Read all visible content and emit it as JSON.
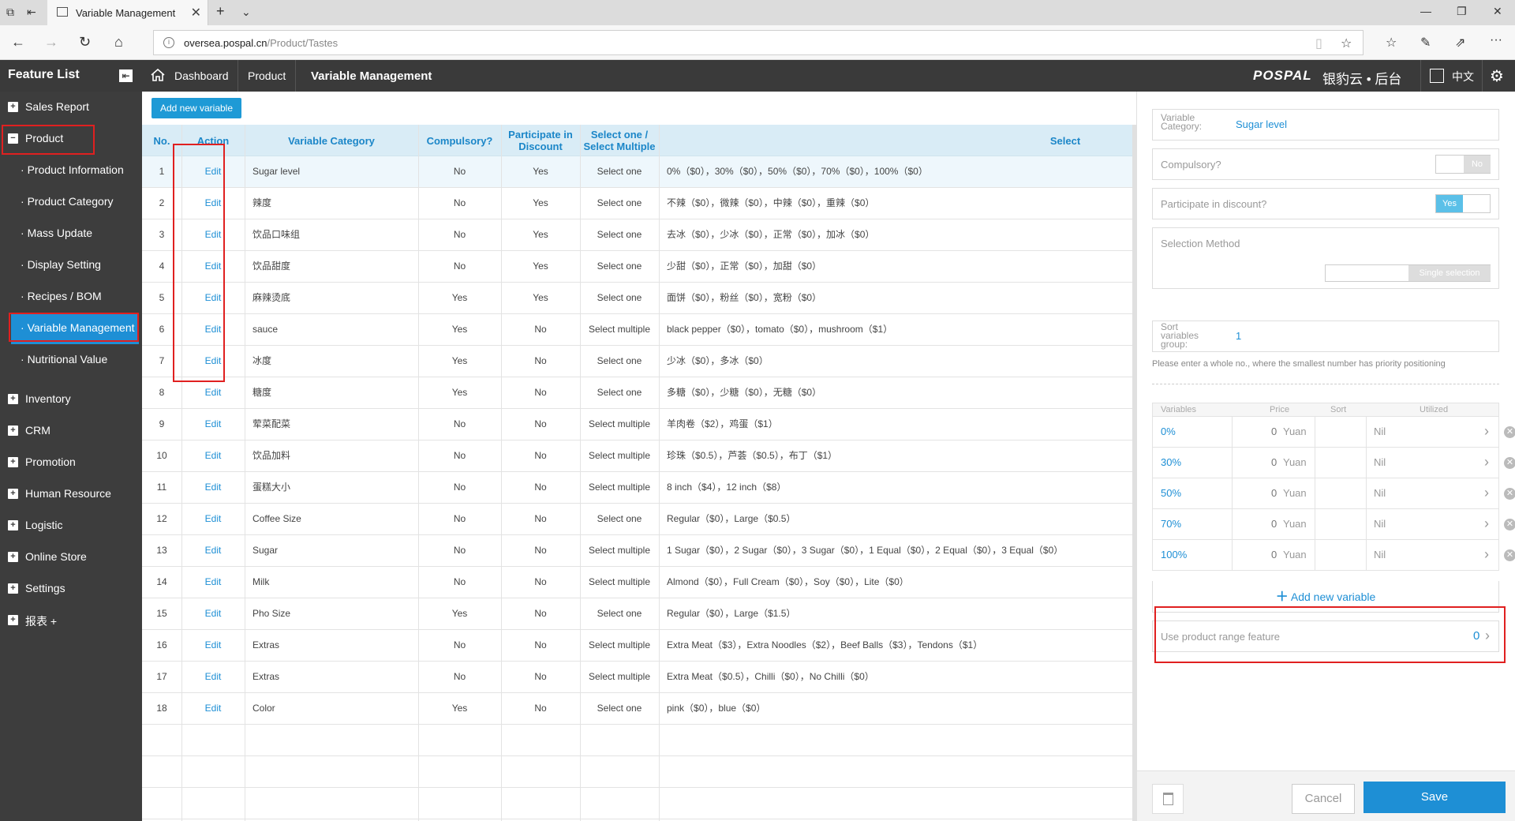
{
  "browser": {
    "tab_title": "Variable Management",
    "url_host": "oversea.pospal.cn",
    "url_path": "/Product/Tastes"
  },
  "header": {
    "feature_title": "Feature List",
    "breadcrumbs": [
      "Dashboard",
      "Product",
      "Variable Management"
    ],
    "brand": "POSPAL",
    "brand_cn": "银豹云 • 后台",
    "language": "中文"
  },
  "sidebar": {
    "items": [
      {
        "label": "Sales Report",
        "type": "group"
      },
      {
        "label": "Product",
        "type": "group-open"
      },
      {
        "label": "Product Information",
        "type": "sub"
      },
      {
        "label": "Product Category",
        "type": "sub"
      },
      {
        "label": "Mass Update",
        "type": "sub"
      },
      {
        "label": "Display Setting",
        "type": "sub"
      },
      {
        "label": "Recipes / BOM",
        "type": "sub"
      },
      {
        "label": "Variable Management",
        "type": "sub-active"
      },
      {
        "label": "Nutritional Value",
        "type": "sub"
      },
      {
        "label": "Inventory",
        "type": "group"
      },
      {
        "label": "CRM",
        "type": "group"
      },
      {
        "label": "Promotion",
        "type": "group"
      },
      {
        "label": "Human Resource",
        "type": "group"
      },
      {
        "label": "Logistic",
        "type": "group"
      },
      {
        "label": "Online Store",
        "type": "group"
      },
      {
        "label": "Settings",
        "type": "group"
      },
      {
        "label": "报表 +",
        "type": "group"
      }
    ]
  },
  "main": {
    "add_button": "Add new variable",
    "columns": {
      "no": "No.",
      "action": "Action",
      "category": "Variable Category",
      "compulsory": "Compulsory?",
      "discount": "Participate in Discount",
      "select_mode": "Select one / Select Multiple",
      "select": "Select"
    },
    "rows": [
      {
        "no": "1",
        "action": "Edit",
        "category": "Sugar level",
        "compulsory": "No",
        "discount": "Yes",
        "mode": "Select one",
        "select": "0%（$0），30%（$0），50%（$0），70%（$0），100%（$0）"
      },
      {
        "no": "2",
        "action": "Edit",
        "category": "辣度",
        "compulsory": "No",
        "discount": "Yes",
        "mode": "Select one",
        "select": "不辣（$0），微辣（$0），中辣（$0），重辣（$0）"
      },
      {
        "no": "3",
        "action": "Edit",
        "category": "饮品口味组",
        "compulsory": "No",
        "discount": "Yes",
        "mode": "Select one",
        "select": "去冰（$0），少冰（$0），正常（$0），加冰（$0）"
      },
      {
        "no": "4",
        "action": "Edit",
        "category": "饮品甜度",
        "compulsory": "No",
        "discount": "Yes",
        "mode": "Select one",
        "select": "少甜（$0），正常（$0），加甜（$0）"
      },
      {
        "no": "5",
        "action": "Edit",
        "category": "麻辣烫底",
        "compulsory": "Yes",
        "discount": "Yes",
        "mode": "Select one",
        "select": "面饼（$0），粉丝（$0），宽粉（$0）"
      },
      {
        "no": "6",
        "action": "Edit",
        "category": "sauce",
        "compulsory": "Yes",
        "discount": "No",
        "mode": "Select multiple",
        "select": "black pepper（$0），tomato（$0），mushroom（$1）"
      },
      {
        "no": "7",
        "action": "Edit",
        "category": "冰度",
        "compulsory": "Yes",
        "discount": "No",
        "mode": "Select one",
        "select": "少冰（$0），多冰（$0）"
      },
      {
        "no": "8",
        "action": "Edit",
        "category": "糖度",
        "compulsory": "Yes",
        "discount": "No",
        "mode": "Select one",
        "select": "多糖（$0），少糖（$0），无糖（$0）"
      },
      {
        "no": "9",
        "action": "Edit",
        "category": "荤菜配菜",
        "compulsory": "No",
        "discount": "No",
        "mode": "Select multiple",
        "select": "羊肉卷（$2），鸡蛋（$1）"
      },
      {
        "no": "10",
        "action": "Edit",
        "category": "饮品加料",
        "compulsory": "No",
        "discount": "No",
        "mode": "Select multiple",
        "select": "珍珠（$0.5），芦荟（$0.5），布丁（$1）"
      },
      {
        "no": "11",
        "action": "Edit",
        "category": "蛋糕大小",
        "compulsory": "No",
        "discount": "No",
        "mode": "Select multiple",
        "select": "8 inch（$4），12 inch（$8）"
      },
      {
        "no": "12",
        "action": "Edit",
        "category": "Coffee Size",
        "compulsory": "No",
        "discount": "No",
        "mode": "Select one",
        "select": "Regular（$0），Large（$0.5）"
      },
      {
        "no": "13",
        "action": "Edit",
        "category": "Sugar",
        "compulsory": "No",
        "discount": "No",
        "mode": "Select multiple",
        "select": "1 Sugar（$0），2 Sugar（$0），3 Sugar（$0），1 Equal（$0），2 Equal（$0），3 Equal（$0）"
      },
      {
        "no": "14",
        "action": "Edit",
        "category": "Milk",
        "compulsory": "No",
        "discount": "No",
        "mode": "Select multiple",
        "select": "Almond（$0），Full Cream（$0），Soy（$0），Lite（$0）"
      },
      {
        "no": "15",
        "action": "Edit",
        "category": "Pho Size",
        "compulsory": "Yes",
        "discount": "No",
        "mode": "Select one",
        "select": "Regular（$0），Large（$1.5）"
      },
      {
        "no": "16",
        "action": "Edit",
        "category": "Extras",
        "compulsory": "No",
        "discount": "No",
        "mode": "Select multiple",
        "select": "Extra Meat（$3），Extra Noodles（$2），Beef Balls（$3），Tendons（$1）"
      },
      {
        "no": "17",
        "action": "Edit",
        "category": "Extras",
        "compulsory": "No",
        "discount": "No",
        "mode": "Select multiple",
        "select": "Extra Meat（$0.5），Chilli（$0），No Chilli（$0）"
      },
      {
        "no": "18",
        "action": "Edit",
        "category": "Color",
        "compulsory": "Yes",
        "discount": "No",
        "mode": "Select one",
        "select": "pink（$0），blue（$0）"
      }
    ]
  },
  "panel": {
    "category_label": "Variable Category:",
    "category_value": "Sugar level",
    "compulsory_label": "Compulsory?",
    "compulsory_value": "No",
    "discount_label": "Participate in discount?",
    "discount_value": "Yes",
    "selection_label": "Selection Method",
    "selection_value": "Single selection",
    "sort_label": "Sort variables group:",
    "sort_value": "1",
    "hint": "Please enter a whole no., where the smallest number has priority positioning",
    "variables_header": {
      "name": "Variables",
      "price": "Price",
      "sort": "Sort",
      "utilized": "Utilized"
    },
    "variables": [
      {
        "name": "0%",
        "price": "0",
        "unit": "Yuan",
        "utilized": "Nil"
      },
      {
        "name": "30%",
        "price": "0",
        "unit": "Yuan",
        "utilized": "Nil"
      },
      {
        "name": "50%",
        "price": "0",
        "unit": "Yuan",
        "utilized": "Nil"
      },
      {
        "name": "70%",
        "price": "0",
        "unit": "Yuan",
        "utilized": "Nil"
      },
      {
        "name": "100%",
        "price": "0",
        "unit": "Yuan",
        "utilized": "Nil"
      }
    ],
    "add_variable": "Add new variable",
    "range_label": "Use product range feature",
    "range_value": "0",
    "cancel": "Cancel",
    "save": "Save"
  },
  "colors": {
    "accent": "#1e8fd5",
    "sidebar": "#3d3d3d",
    "header": "#3a3a3a",
    "highlight": "#e02020"
  }
}
